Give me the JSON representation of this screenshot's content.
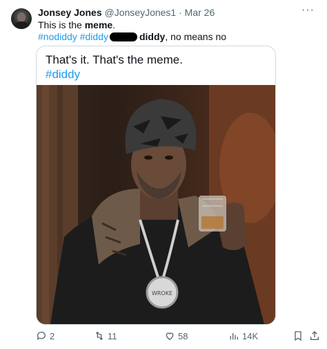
{
  "author": {
    "name": "Jonsey Jones",
    "handle": "@JonseyJones1",
    "separator": "·",
    "date": "Mar 26"
  },
  "tweet": {
    "line1_prefix": "This is the ",
    "line1_bold": "meme",
    "line1_suffix": ".",
    "hashtag1": "#nodiddy",
    "hashtag2": "#diddy",
    "redacted_tail": "diddy",
    "line2_suffix": ", no means no"
  },
  "card": {
    "caption": "That's it. That's the meme.",
    "hashtag": "#diddy"
  },
  "actions": {
    "replies": "2",
    "retweets": "11",
    "likes": "58",
    "views": "14K"
  },
  "icons": [
    "more-icon",
    "reply-icon",
    "retweet-icon",
    "like-icon",
    "views-icon",
    "bookmark-icon",
    "share-icon"
  ],
  "colors": {
    "link": "#1d9bf0",
    "muted": "#536471",
    "text": "#0f1419"
  }
}
